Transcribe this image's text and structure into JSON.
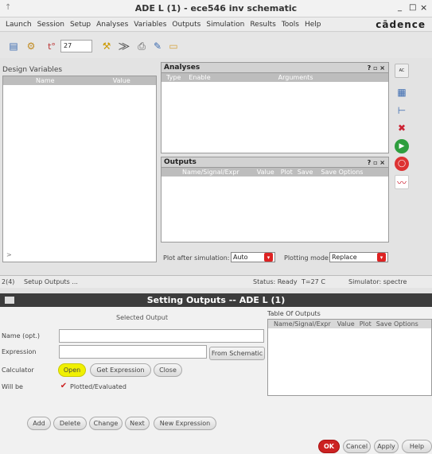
{
  "ade_window": {
    "title": "ADE L (1) - ece546 inv schematic",
    "title_controls": [
      "_",
      "□",
      "×"
    ],
    "menus": [
      "Launch",
      "Session",
      "Setup",
      "Analyses",
      "Variables",
      "Outputs",
      "Simulation",
      "Results",
      "Tools",
      "Help"
    ],
    "brand": "cādence",
    "temperature_value": "27",
    "design_variables": {
      "title": "Design Variables",
      "columns": [
        "Name",
        "Value"
      ],
      "footer": ">"
    },
    "analyses": {
      "title": "Analyses",
      "controls": "? ▫ ×",
      "columns": [
        "Type",
        "Enable",
        "Arguments"
      ]
    },
    "outputs": {
      "title": "Outputs",
      "controls": "? ▫ ×",
      "columns": [
        "Name/Signal/Expr",
        "Value",
        "Plot",
        "Save",
        "Save Options"
      ]
    },
    "plot_after_simulation": {
      "label": "Plot after simulation:",
      "value": "Auto"
    },
    "plotting_mode": {
      "label": "Plotting mode:",
      "value": "Replace"
    },
    "status_bar": {
      "left": "2(4)",
      "message": "Setup Outputs ...",
      "status": "Status: Ready",
      "temp": "T=27  C",
      "simulator": "Simulator: spectre"
    }
  },
  "dialog": {
    "title": "Setting Outputs -- ADE L (1)",
    "selected_output": "Selected Output",
    "table_of_outputs": "Table Of Outputs",
    "table_columns": [
      "Name/Signal/Expr",
      "Value",
      "Plot",
      "Save Options"
    ],
    "name_label": "Name (opt.)",
    "name_value": "",
    "expression_label": "Expression",
    "expression_value": "",
    "from_schematic": "From Schematic",
    "calculator_label": "Calculator",
    "open": "Open",
    "get_expression": "Get Expression",
    "close": "Close",
    "will_be_label": "Will be",
    "plotted_evaluated": "Plotted/Evaluated",
    "plotted_checked": true,
    "bottom_buttons": [
      "Add",
      "Delete",
      "Change",
      "Next",
      "New Expression"
    ],
    "ok": "OK",
    "cancel": "Cancel",
    "apply": "Apply",
    "help": "Help"
  },
  "colors": {
    "ok_button": "#cc2222",
    "open_highlight": "#f0f000",
    "dialog_titlebar": "#3c3c3c"
  }
}
